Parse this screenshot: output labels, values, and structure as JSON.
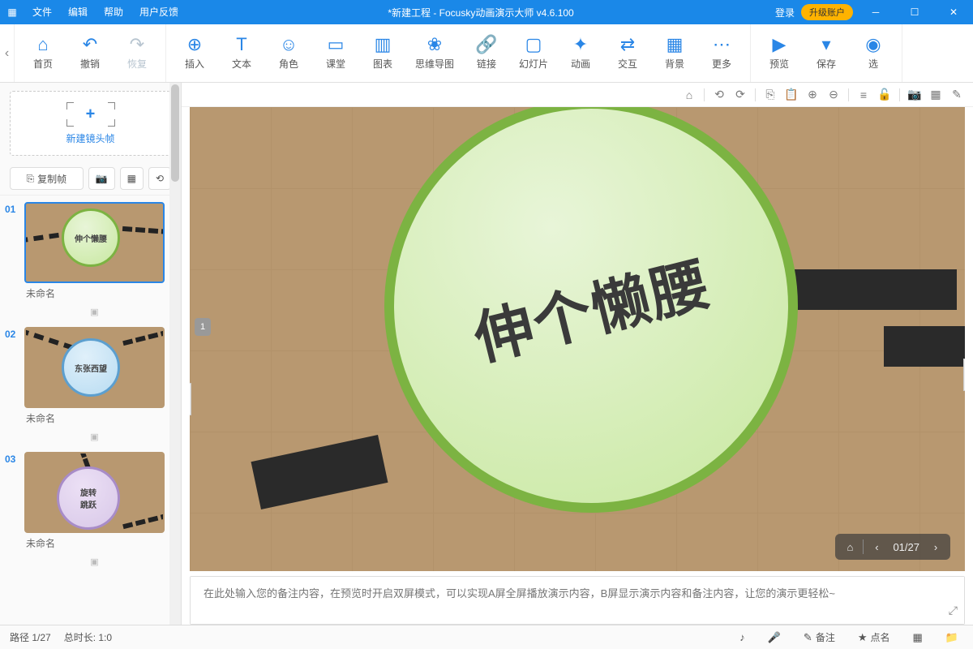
{
  "titlebar": {
    "menus": {
      "file": "文件",
      "edit": "编辑",
      "help": "帮助",
      "feedback": "用户反馈"
    },
    "title": "*新建工程 - Focusky动画演示大师  v4.6.100",
    "login": "登录",
    "upgrade": "升级账户"
  },
  "toolbar": {
    "home": "首页",
    "undo": "撤销",
    "redo": "恢复",
    "insert": "插入",
    "text": "文本",
    "role": "角色",
    "class": "课堂",
    "chart": "图表",
    "mindmap": "思维导图",
    "link": "链接",
    "slide": "幻灯片",
    "anim": "动画",
    "interact": "交互",
    "bg": "背景",
    "more": "更多",
    "preview": "预览",
    "save": "保存",
    "select": "选"
  },
  "sidebar": {
    "new_frame": "新建镜头帧",
    "copy_frame": "复制帧",
    "frames": [
      {
        "num": "01",
        "name": "未命名",
        "circle_text": "伸个懒腰",
        "circle_color": "#c8e8a0",
        "border": "#7cb342"
      },
      {
        "num": "02",
        "name": "未命名",
        "circle_text": "东张西望",
        "circle_color": "#b8dcf2",
        "border": "#5c9fcf"
      },
      {
        "num": "03",
        "name": "未命名",
        "circle_text": "旋转\n跳跃",
        "circle_color": "#d8c8e8",
        "border": "#a88cc8"
      }
    ]
  },
  "canvas": {
    "main_text": "伸个懒腰",
    "tab_num": "1",
    "pager": {
      "current": "01",
      "total": "27",
      "display": "01/27"
    }
  },
  "notes": {
    "placeholder": "在此处输入您的备注内容，在预览时开启双屏模式，可以实现A屏全屏播放演示内容，B屏显示演示内容和备注内容，让您的演示更轻松~"
  },
  "statusbar": {
    "path": "路径 1/27",
    "duration": "总时长: 1:0",
    "notes_btn": "备注",
    "like_btn": "点名"
  }
}
